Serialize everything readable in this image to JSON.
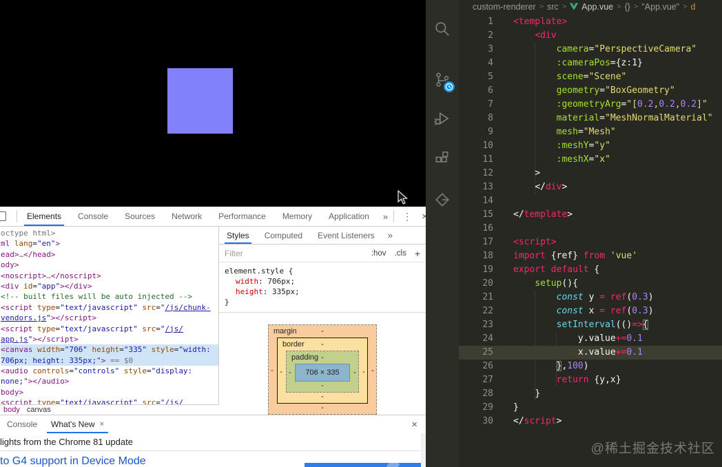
{
  "viewport": {
    "square_color": "#8281fa"
  },
  "devtools": {
    "tabs": [
      "Elements",
      "Console",
      "Sources",
      "Network",
      "Performance",
      "Memory",
      "Application"
    ],
    "active_tab": "Elements",
    "more_label": "»",
    "kebab_icon": "⋮",
    "close_icon": "×",
    "elements_tree": {
      "rows": [
        {
          "hl": false,
          "segs": [
            [
              "octype html>",
              "gr"
            ]
          ]
        },
        {
          "hl": false,
          "segs": [
            [
              "ml ",
              "t"
            ],
            [
              "lang",
              "a"
            ],
            [
              "=",
              "b"
            ],
            [
              "\"en\"",
              "v"
            ],
            [
              ">",
              "t"
            ]
          ]
        },
        {
          "hl": false,
          "segs": [
            [
              "ead>",
              "t"
            ],
            [
              "…",
              "gr"
            ],
            [
              "</head>",
              "t"
            ]
          ]
        },
        {
          "hl": false,
          "segs": [
            [
              "ody>",
              "t"
            ]
          ]
        },
        {
          "hl": false,
          "segs": [
            [
              "<noscript>",
              "t"
            ],
            [
              "…",
              "gr"
            ],
            [
              "</noscript>",
              "t"
            ]
          ]
        },
        {
          "hl": false,
          "segs": [
            [
              "<div ",
              "t"
            ],
            [
              "id",
              "a"
            ],
            [
              "=",
              "b"
            ],
            [
              "\"app\"",
              "v"
            ],
            [
              "></div>",
              "t"
            ]
          ]
        },
        {
          "hl": false,
          "segs": [
            [
              "<!-- built files will be auto injected -->",
              "cm"
            ]
          ]
        },
        {
          "hl": false,
          "segs": [
            [
              "<script ",
              "t"
            ],
            [
              "type",
              "a"
            ],
            [
              "=",
              "b"
            ],
            [
              "\"text/javascript\"",
              "v"
            ],
            [
              " ",
              "b"
            ],
            [
              "src",
              "a"
            ],
            [
              "=",
              "b"
            ],
            [
              "\"",
              "v"
            ],
            [
              "/js/chunk-",
              "l"
            ]
          ]
        },
        {
          "hl": false,
          "segs": [
            [
              "vendors.js",
              "l"
            ],
            [
              "\"",
              "v"
            ],
            [
              "></script>",
              "t"
            ]
          ]
        },
        {
          "hl": false,
          "segs": [
            [
              "<script ",
              "t"
            ],
            [
              "type",
              "a"
            ],
            [
              "=",
              "b"
            ],
            [
              "\"text/javascript\"",
              "v"
            ],
            [
              " ",
              "b"
            ],
            [
              "src",
              "a"
            ],
            [
              "=",
              "b"
            ],
            [
              "\"",
              "v"
            ],
            [
              "/js/",
              "l"
            ]
          ]
        },
        {
          "hl": false,
          "segs": [
            [
              "app.js",
              "l"
            ],
            [
              "\"",
              "v"
            ],
            [
              "></script>",
              "t"
            ]
          ]
        },
        {
          "hl": true,
          "segs": [
            [
              "<canvas ",
              "t"
            ],
            [
              "width",
              "a"
            ],
            [
              "=",
              "b"
            ],
            [
              "\"706\"",
              "v"
            ],
            [
              " ",
              "b"
            ],
            [
              "height",
              "a"
            ],
            [
              "=",
              "b"
            ],
            [
              "\"335\"",
              "v"
            ],
            [
              " ",
              "b"
            ],
            [
              "style",
              "a"
            ],
            [
              "=",
              "b"
            ],
            [
              "\"width:",
              "v"
            ]
          ]
        },
        {
          "hl": true,
          "segs": [
            [
              "706px; height: 335px;",
              "v"
            ],
            [
              "\">",
              "t"
            ],
            [
              " == $0",
              "gr"
            ]
          ]
        },
        {
          "hl": false,
          "segs": [
            [
              "<audio ",
              "t"
            ],
            [
              "controls",
              "a"
            ],
            [
              "=",
              "b"
            ],
            [
              "\"controls\"",
              "v"
            ],
            [
              " ",
              "b"
            ],
            [
              "style",
              "a"
            ],
            [
              "=",
              "b"
            ],
            [
              "\"display:",
              "v"
            ]
          ]
        },
        {
          "hl": false,
          "segs": [
            [
              "none;",
              "v"
            ],
            [
              "\"></audio>",
              "t"
            ]
          ]
        },
        {
          "hl": false,
          "segs": [
            [
              "body>",
              "t"
            ]
          ]
        },
        {
          "hl": false,
          "segs": [
            [
              "<script ",
              "t"
            ],
            [
              "type",
              "a"
            ],
            [
              "=",
              "b"
            ],
            [
              "\"text/javascript\"",
              "v"
            ],
            [
              " ",
              "b"
            ],
            [
              "src",
              "a"
            ],
            [
              "=",
              "b"
            ],
            [
              "\"",
              "v"
            ],
            [
              "/js/",
              "l"
            ]
          ]
        }
      ],
      "breadcrumb": [
        "body",
        "canvas"
      ]
    },
    "styles": {
      "tabs": [
        "Styles",
        "Computed",
        "Event Listeners"
      ],
      "active_tab": "Styles",
      "more_label": "»",
      "filter_placeholder": "Filter",
      "toggles": [
        ":hov",
        ".cls",
        "+"
      ],
      "rule": {
        "selector_open": "element.style {",
        "properties": [
          {
            "name": "width",
            "value": "706px;"
          },
          {
            "name": "height",
            "value": "335px;"
          }
        ],
        "close": "}"
      },
      "box_model": {
        "margin_label": "margin",
        "border_label": "border",
        "padding_label": "padding",
        "side_value": "-",
        "content": "706 × 335"
      }
    },
    "drawer": {
      "tabs": [
        "Console",
        "What's New"
      ],
      "active_tab": "What's New",
      "tab_close_icon": "×",
      "close_icon": "×",
      "message": "lights from the Chrome 81 update",
      "link": "to G4 support in Device Mode"
    }
  },
  "editor": {
    "breadcrumb": [
      {
        "label": "custom-renderer"
      },
      {
        "label": "src"
      },
      {
        "label": "App.vue",
        "icon": "vue",
        "hi": true
      },
      {
        "label": "{}"
      },
      {
        "label": "\"App.vue\""
      },
      {
        "label": "d",
        "partial": true
      }
    ],
    "current_line": 25,
    "lines": [
      {
        "n": 1,
        "i": 0,
        "s": [
          [
            "<template>",
            "p"
          ]
        ]
      },
      {
        "n": 2,
        "i": 4,
        "s": [
          [
            "<div",
            "p"
          ]
        ]
      },
      {
        "n": 3,
        "i": 8,
        "s": [
          [
            "camera",
            "g"
          ],
          [
            "=",
            "w"
          ],
          [
            "\"PerspectiveCamera\"",
            "y"
          ]
        ]
      },
      {
        "n": 4,
        "i": 8,
        "s": [
          [
            ":cameraPos",
            "g"
          ],
          [
            "=",
            "w"
          ],
          [
            "{z:1}",
            "w"
          ]
        ]
      },
      {
        "n": 5,
        "i": 8,
        "s": [
          [
            "scene",
            "g"
          ],
          [
            "=",
            "w"
          ],
          [
            "\"Scene\"",
            "y"
          ]
        ]
      },
      {
        "n": 6,
        "i": 8,
        "s": [
          [
            "geometry",
            "g"
          ],
          [
            "=",
            "w"
          ],
          [
            "\"BoxGeometry\"",
            "y"
          ]
        ]
      },
      {
        "n": 7,
        "i": 8,
        "s": [
          [
            ":geometryArg",
            "g"
          ],
          [
            "=",
            "w"
          ],
          [
            "\"[",
            "y"
          ],
          [
            "0.2",
            "u"
          ],
          [
            ",",
            "y"
          ],
          [
            "0.2",
            "u"
          ],
          [
            ",",
            "y"
          ],
          [
            "0.2",
            "u"
          ],
          [
            "]\"",
            "y"
          ]
        ]
      },
      {
        "n": 8,
        "i": 8,
        "s": [
          [
            "material",
            "g"
          ],
          [
            "=",
            "w"
          ],
          [
            "\"MeshNormalMaterial\"",
            "y"
          ]
        ]
      },
      {
        "n": 9,
        "i": 8,
        "s": [
          [
            "mesh",
            "g"
          ],
          [
            "=",
            "w"
          ],
          [
            "\"Mesh\"",
            "y"
          ]
        ]
      },
      {
        "n": 10,
        "i": 8,
        "s": [
          [
            ":meshY",
            "g"
          ],
          [
            "=",
            "w"
          ],
          [
            "\"y\"",
            "y"
          ]
        ]
      },
      {
        "n": 11,
        "i": 8,
        "s": [
          [
            ":meshX",
            "g"
          ],
          [
            "=",
            "w"
          ],
          [
            "\"x\"",
            "y"
          ]
        ]
      },
      {
        "n": 12,
        "i": 4,
        "s": [
          [
            ">",
            "w"
          ]
        ]
      },
      {
        "n": 13,
        "i": 4,
        "s": [
          [
            "</",
            "w"
          ],
          [
            "div",
            "p"
          ],
          [
            ">",
            "w"
          ]
        ]
      },
      {
        "n": 14,
        "i": 0,
        "s": []
      },
      {
        "n": 15,
        "i": 0,
        "s": [
          [
            "</",
            "w"
          ],
          [
            "template",
            "p"
          ],
          [
            ">",
            "w"
          ]
        ]
      },
      {
        "n": 16,
        "i": 0,
        "s": []
      },
      {
        "n": 17,
        "i": 0,
        "s": [
          [
            "<script>",
            "p"
          ]
        ]
      },
      {
        "n": 18,
        "i": 0,
        "s": [
          [
            "import",
            "p"
          ],
          [
            " {ref} ",
            "w"
          ],
          [
            "from",
            "p"
          ],
          [
            " ",
            "w"
          ],
          [
            "'vue'",
            "y"
          ]
        ]
      },
      {
        "n": 19,
        "i": 0,
        "s": [
          [
            "export",
            "p"
          ],
          [
            " ",
            "w"
          ],
          [
            "default",
            "p"
          ],
          [
            " {",
            "w"
          ]
        ]
      },
      {
        "n": 20,
        "i": 4,
        "s": [
          [
            "setup",
            "g"
          ],
          [
            "(){",
            "w"
          ]
        ]
      },
      {
        "n": 21,
        "i": 8,
        "s": [
          [
            "const",
            "ci"
          ],
          [
            " y ",
            "w"
          ],
          [
            "=",
            "p"
          ],
          [
            " ",
            "w"
          ],
          [
            "ref",
            "p"
          ],
          [
            "(",
            "w"
          ],
          [
            "0.3",
            "u"
          ],
          [
            ")",
            "w"
          ]
        ]
      },
      {
        "n": 22,
        "i": 8,
        "s": [
          [
            "const",
            "ci"
          ],
          [
            " x ",
            "w"
          ],
          [
            "=",
            "p"
          ],
          [
            " ",
            "w"
          ],
          [
            "ref",
            "p"
          ],
          [
            "(",
            "w"
          ],
          [
            "0.3",
            "u"
          ],
          [
            ")",
            "w"
          ]
        ]
      },
      {
        "n": 23,
        "i": 8,
        "s": [
          [
            "setInterval",
            "c"
          ],
          [
            "(()",
            "w"
          ],
          [
            "=>",
            "p"
          ],
          [
            "{",
            "wb"
          ]
        ]
      },
      {
        "n": 24,
        "i": 12,
        "s": [
          [
            "y.value",
            "w"
          ],
          [
            "+=",
            "p"
          ],
          [
            "0.1",
            "u"
          ]
        ]
      },
      {
        "n": 25,
        "i": 12,
        "s": [
          [
            "x.value",
            "w"
          ],
          [
            "+=",
            "p"
          ],
          [
            "0.1",
            "u"
          ]
        ]
      },
      {
        "n": 26,
        "i": 8,
        "s": [
          [
            "}",
            "wb"
          ],
          [
            ",",
            "w"
          ],
          [
            "100",
            "u"
          ],
          [
            ")",
            "w"
          ]
        ]
      },
      {
        "n": 27,
        "i": 8,
        "s": [
          [
            "return",
            "p"
          ],
          [
            " {y,x}",
            "w"
          ]
        ]
      },
      {
        "n": 28,
        "i": 4,
        "s": [
          [
            "}",
            "w"
          ]
        ]
      },
      {
        "n": 29,
        "i": 0,
        "s": [
          [
            "}",
            "w"
          ]
        ]
      },
      {
        "n": 30,
        "i": 0,
        "s": [
          [
            "</",
            "w"
          ],
          [
            "script",
            "p"
          ],
          [
            ">",
            "w"
          ]
        ]
      }
    ],
    "watermark": "@稀土掘金技术社区"
  }
}
